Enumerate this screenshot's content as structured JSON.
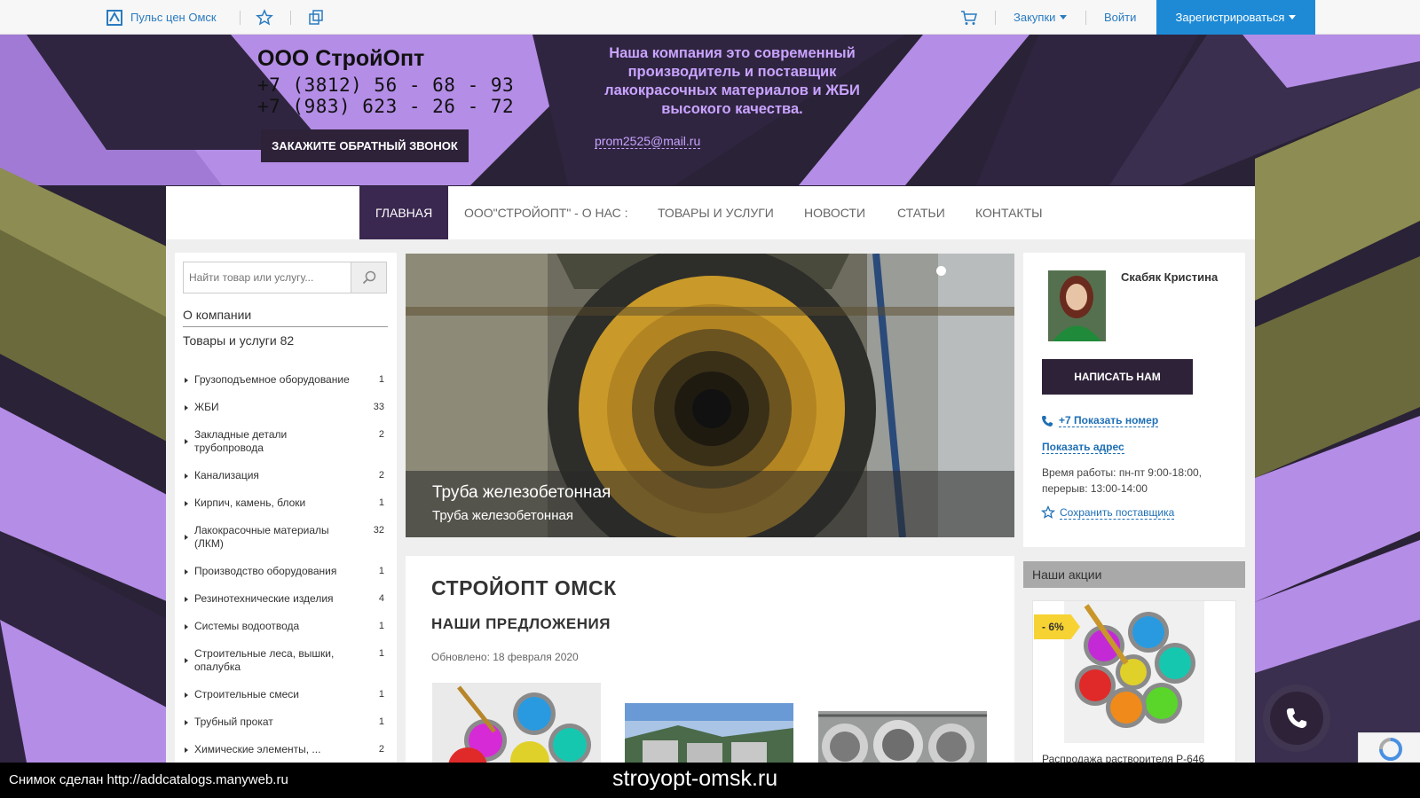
{
  "topbar": {
    "brand": "Пульс цен Омск",
    "purchases": "Закупки",
    "login": "Войти",
    "register": "Зарегистрироваться"
  },
  "header": {
    "company": "ООО СтройОпт",
    "phone1": "+7 (3812) 56 - 68 - 93",
    "phone2": "+7 (983) 623 - 26 - 72",
    "callback": "ЗАКАЖИТЕ ОБРАТНЫЙ ЗВОНОК",
    "slogan": "Наша компания это современный производитель и поставщик лакокрасочных материалов  и ЖБИ высокого качества.",
    "email": "prom2525@mail.ru"
  },
  "nav": [
    {
      "label": "ГЛАВНАЯ",
      "active": true
    },
    {
      "label": "ООО\"СТРОЙОПТ\" - О НАС :"
    },
    {
      "label": "ТОВАРЫ И УСЛУГИ"
    },
    {
      "label": "НОВОСТИ"
    },
    {
      "label": "СТАТЬИ"
    },
    {
      "label": "КОНТАКТЫ"
    }
  ],
  "sidebar": {
    "search_placeholder": "Найти товар или услугу...",
    "about": "О компании",
    "goods": "Товары и услуги 82",
    "categories": [
      {
        "name": "Грузоподъемное оборудование",
        "count": "1"
      },
      {
        "name": "ЖБИ",
        "count": "33"
      },
      {
        "name": "Закладные детали трубопровода",
        "count": "2"
      },
      {
        "name": "Канализация",
        "count": "2"
      },
      {
        "name": "Кирпич, камень, блоки",
        "count": "1"
      },
      {
        "name": "Лакокрасочные материалы (ЛКМ)",
        "count": "32"
      },
      {
        "name": "Производство оборудования",
        "count": "1"
      },
      {
        "name": "Резинотехнические изделия",
        "count": "4"
      },
      {
        "name": "Системы водоотвода",
        "count": "1"
      },
      {
        "name": "Строительные леса, вышки, опалубка",
        "count": "1"
      },
      {
        "name": "Строительные смеси",
        "count": "1"
      },
      {
        "name": "Трубный прокат",
        "count": "1"
      },
      {
        "name": "Химические элементы, ...",
        "count": "2"
      }
    ]
  },
  "slider": {
    "title": "Труба железобетонная",
    "subtitle": "Труба железобетонная"
  },
  "content": {
    "title": "СТРОЙОПТ ОМСК",
    "subtitle": "НАШИ ПРЕДЛОЖЕНИЯ",
    "updated": "Обновлено: 18 февраля 2020"
  },
  "manager": {
    "name": "Скабяк Кристина",
    "write": "НАПИСАТЬ НАМ",
    "show_phone": "+7 Показать номер",
    "show_address": "Показать адрес",
    "hours1": "Время работы: пн-пт 9:00-18:00,",
    "hours2": "перерыв: 13:00-14:00",
    "save": "Сохранить поставщика"
  },
  "promo": {
    "header": "Наши акции",
    "badge": "- 6%",
    "title": "Распродажа растворителя Р-646"
  },
  "footer": {
    "left": "Снимок сделан http://addcatalogs.manyweb.ru",
    "center": "stroyopt-omsk.ru"
  },
  "colors": {
    "accent": "#3a2850",
    "register": "#1e8ad6",
    "lilac": "#b48de6",
    "olive": "#8d8c52"
  }
}
